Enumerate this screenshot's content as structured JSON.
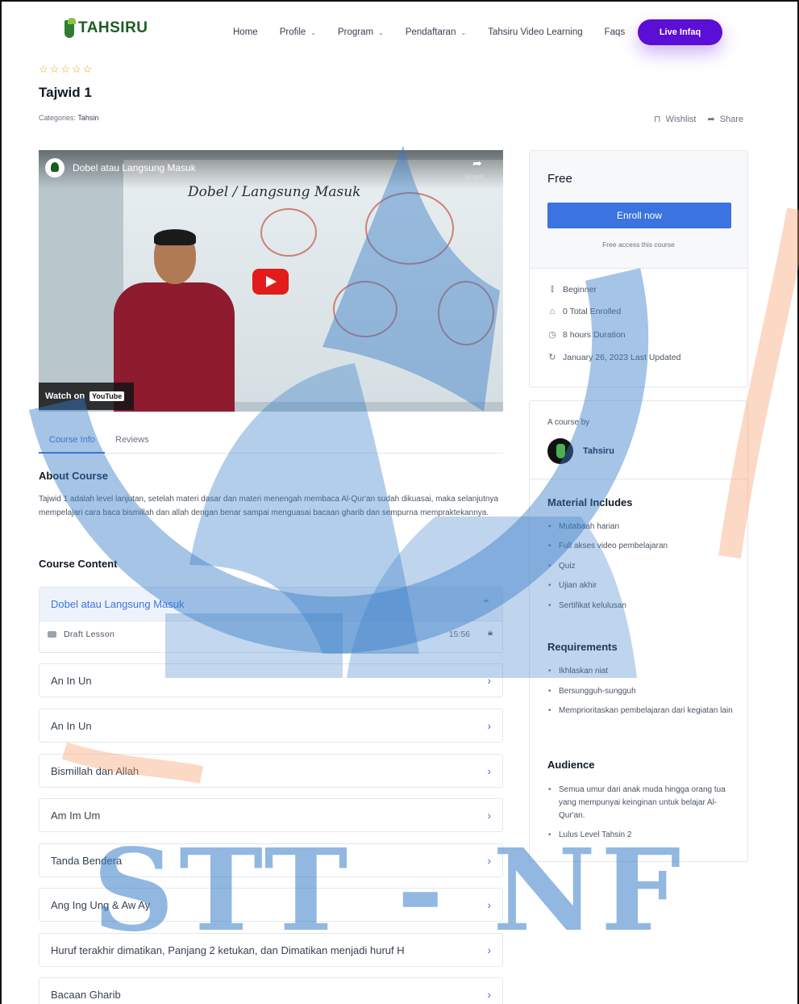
{
  "nav": {
    "logo_text": "TAHSIRU",
    "items": [
      {
        "label": "Home",
        "dropdown": false
      },
      {
        "label": "Profile",
        "dropdown": true
      },
      {
        "label": "Program",
        "dropdown": true
      },
      {
        "label": "Pendaftaran",
        "dropdown": true
      },
      {
        "label": "Tahsiru Video Learning",
        "dropdown": false
      },
      {
        "label": "Faqs",
        "dropdown": false
      }
    ],
    "cta": "Live Infaq",
    "cta_color": "#5b0ed6"
  },
  "course": {
    "rating_stars": "☆☆☆☆☆",
    "title": "Tajwid 1",
    "categories_label": "Categories:",
    "category": "Tahsin",
    "wishlist": "Wishlist",
    "share": "Share"
  },
  "video": {
    "title": "Dobel atau Langsung Masuk",
    "board_text": "Dobel / Langsung Masuk",
    "share": "Share",
    "watch_on": "Watch on",
    "youtube": "YouTube"
  },
  "tabs": [
    "Course Info",
    "Reviews"
  ],
  "about": {
    "heading": "About Course",
    "text": "Tajwid 1 adalah level lanjutan, setelah materi dasar dan materi menengah membaca Al-Qur'an sudah dikuasai, maka selanjutnya mempelajari cara baca bismillah dan allah dengan benar sampai menguasai bacaan gharib dan sempurna mempraktekannya."
  },
  "content": {
    "heading": "Course Content",
    "topics": [
      {
        "title": "Dobel atau Langsung Masuk",
        "open": true,
        "lesson": {
          "name": "Draft Lesson",
          "duration": "15:56"
        }
      },
      {
        "title": "An In Un"
      },
      {
        "title": "An In Un"
      },
      {
        "title": "Bismillah dan Allah"
      },
      {
        "title": "Am Im Um"
      },
      {
        "title": "Tanda Bendera"
      },
      {
        "title": "Ang Ing Ung & Aw Ay"
      },
      {
        "title": "Huruf terakhir dimatikan, Panjang 2 ketukan, dan Dimatikan menjadi huruf H"
      },
      {
        "title": "Bacaan Gharib"
      }
    ]
  },
  "enroll_card": {
    "price": "Free",
    "button": "Enroll now",
    "note": "Free access this course",
    "level": "Beginner",
    "enrolled": "0 Total Enrolled",
    "duration": "8 hours  Duration",
    "updated": "January 26, 2023 Last Updated",
    "accent": "#3b73e0"
  },
  "instructor_card": {
    "by_label": "A course by",
    "name": "Tahsiru",
    "materials_heading": "Material Includes",
    "materials": [
      "Mutabaah harian",
      "Full akses video pembelajaran",
      "Quiz",
      "Ujian akhir",
      "Sertifikat kelulusan"
    ],
    "requirements_heading": "Requirements",
    "requirements": [
      "Ikhlaskan niat",
      "Bersungguh-sungguh",
      "Memprioritaskan pembelajaran dari kegiatan lain"
    ],
    "audience_heading": "Audience",
    "audience": [
      "Semua umur dari anak muda hingga orang tua yang mempunyai keinginan untuk belajar Al-Qur'an.",
      "Lulus Level Tahsin 2"
    ]
  },
  "watermark": {
    "text": "STT - NF",
    "color": "#387dc8"
  }
}
